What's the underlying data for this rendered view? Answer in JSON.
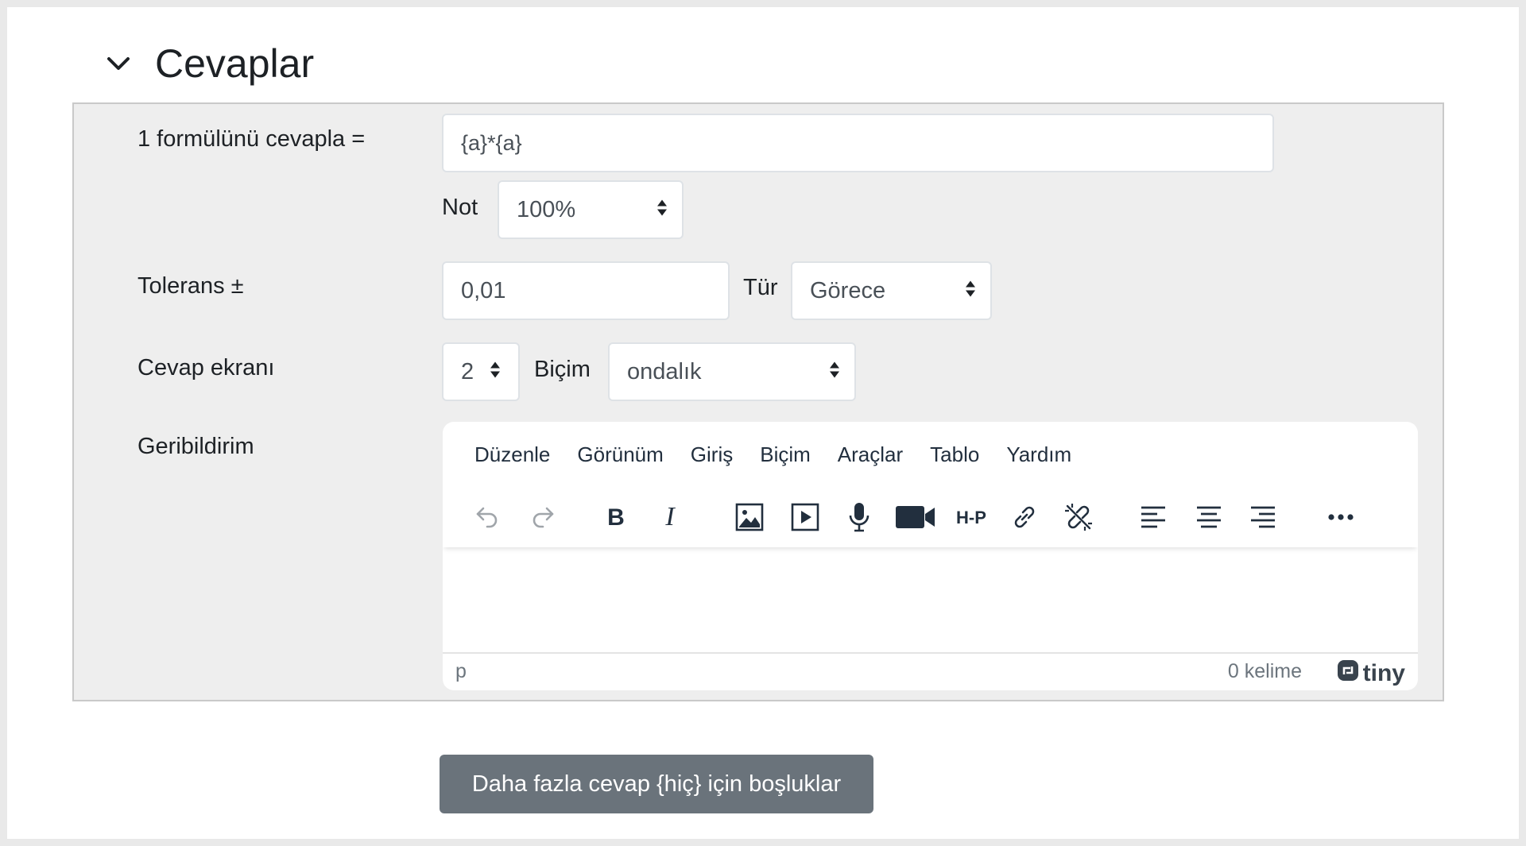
{
  "section": {
    "title": "Cevaplar"
  },
  "answer": {
    "formula_label": "1 formülünü cevapla =",
    "formula_value": "{a}*{a}",
    "grade_label": "Not",
    "grade_value": "100%"
  },
  "tolerance": {
    "label": "Tolerans ±",
    "value": "0,01",
    "type_label": "Tür",
    "type_value": "Görece"
  },
  "display": {
    "label": "Cevap ekranı",
    "digits_value": "2",
    "format_label": "Biçim",
    "format_value": "ondalık"
  },
  "feedback": {
    "label": "Geribildirim",
    "editor": {
      "menu": [
        "Düzenle",
        "Görünüm",
        "Giriş",
        "Biçim",
        "Araçlar",
        "Tablo",
        "Yardım"
      ],
      "path": "p",
      "wordcount": "0 kelime",
      "brand": "tiny"
    }
  },
  "more_button": "Daha fazla cevap {hiç} için boşluklar",
  "icons": [
    "chevron-down-icon",
    "undo-icon",
    "redo-icon",
    "bold-icon",
    "italic-icon",
    "image-icon",
    "media-icon",
    "microphone-icon",
    "video-camera-icon",
    "h5p-icon",
    "link-icon",
    "unlink-icon",
    "align-left-icon",
    "align-center-icon",
    "align-right-icon",
    "more-icon",
    "select-arrow-icon",
    "tiny-logo-icon"
  ]
}
